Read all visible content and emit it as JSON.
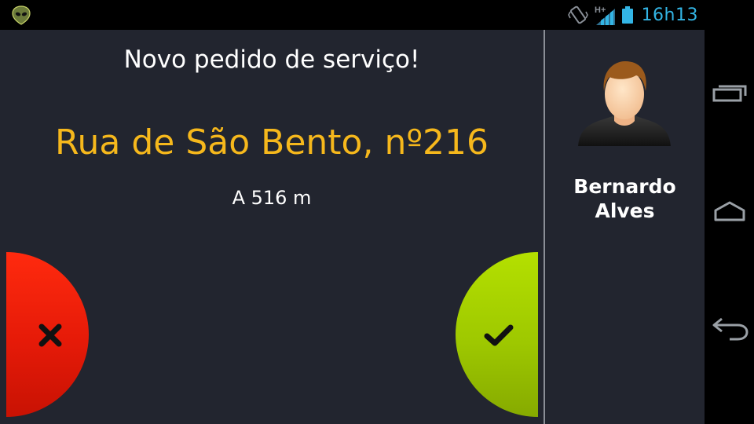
{
  "status_bar": {
    "time": "16h13",
    "network_label": "H+",
    "icons": [
      "app-alien-icon",
      "vibrate-icon",
      "signal-icon",
      "battery-icon"
    ],
    "accent_color": "#33b5e5"
  },
  "request": {
    "title": "Novo pedido de serviço!",
    "address": "Rua de São Bento, nº216",
    "distance": "A 516 m",
    "address_color": "#f6b81c"
  },
  "actions": {
    "reject_icon": "close-icon",
    "accept_icon": "checkmark-icon",
    "reject_color": "#e51a08",
    "accept_color": "#9ec800"
  },
  "client": {
    "first_name": "Bernardo",
    "last_name": "Alves",
    "avatar_icon": "user-avatar-icon"
  },
  "nav": {
    "icons": [
      "recent-apps-icon",
      "home-icon",
      "back-icon"
    ]
  }
}
